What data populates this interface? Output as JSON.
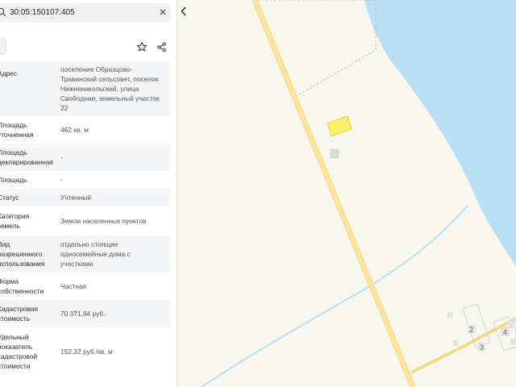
{
  "search": {
    "query": "30:05:150107:405",
    "search_icon": "search-icon",
    "close_icon": "close-icon"
  },
  "toolbar": {
    "favorite_icon": "star-icon",
    "share_icon": "share-icon",
    "collapse_icon": "chevron-left-icon"
  },
  "attributes": [
    {
      "label": "Адрес",
      "value": "поселение Образцово-\nТравинский сельсовет, поселок\nНижненикольский, улица\nСвободная, земельный участок\n22"
    },
    {
      "label": "Площадь\nуточненная",
      "value": "462 кв. м"
    },
    {
      "label": "Площадь\nдекларированная",
      "value": "-"
    },
    {
      "label": "Площадь",
      "value": "-"
    },
    {
      "label": "Статус",
      "value": "Учтенный"
    },
    {
      "label": "Категория\nземель",
      "value": "Земли населенных пунктов"
    },
    {
      "label": "Вид\nразрешенного\nиспользования",
      "value": "отдельно стоящие\nодносемейные дома с\nучастками"
    },
    {
      "label": "Форма\nсобственности",
      "value": "Частная"
    },
    {
      "label": "Кадастровая\nстоимость",
      "value": "70 371,84 руб."
    },
    {
      "label": "Удельный\nпоказатель\nкадастровой\nстоимости",
      "value": "152,32 руб./кв. м"
    }
  ],
  "map": {
    "house_numbers": [
      "2",
      "3",
      "4"
    ],
    "colors": {
      "water": "#b9dff5",
      "road": "#fbe59a",
      "parcel": "#f7f26a",
      "parcel_border": "#e5cf2a",
      "land": "#f8f7ee"
    }
  }
}
